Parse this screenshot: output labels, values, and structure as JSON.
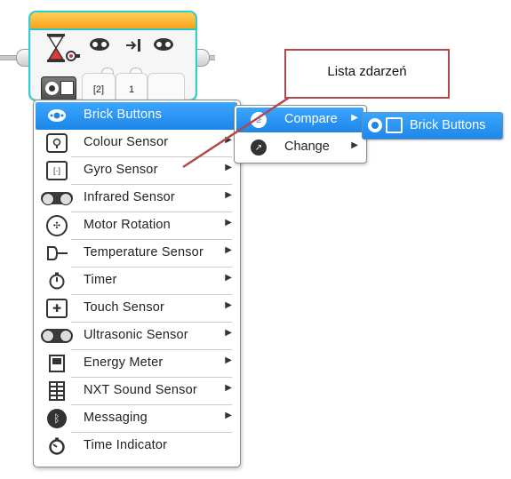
{
  "block": {
    "param1": "[2]",
    "param2": "1"
  },
  "menu": {
    "items": [
      {
        "label": "Brick Buttons",
        "icon": "brick-buttons-icon",
        "selected": true,
        "has_submenu": true
      },
      {
        "label": "Colour Sensor",
        "icon": "colour-sensor-icon",
        "has_submenu": true
      },
      {
        "label": "Gyro Sensor",
        "icon": "gyro-sensor-icon",
        "has_submenu": true
      },
      {
        "label": "Infrared Sensor",
        "icon": "infrared-sensor-icon",
        "has_submenu": true
      },
      {
        "label": "Motor Rotation",
        "icon": "motor-rotation-icon",
        "has_submenu": true
      },
      {
        "label": "Temperature Sensor",
        "icon": "temperature-sensor-icon",
        "has_submenu": true
      },
      {
        "label": "Timer",
        "icon": "timer-icon",
        "has_submenu": true
      },
      {
        "label": "Touch Sensor",
        "icon": "touch-sensor-icon",
        "has_submenu": true
      },
      {
        "label": "Ultrasonic Sensor",
        "icon": "ultrasonic-sensor-icon",
        "has_submenu": true
      },
      {
        "label": "Energy Meter",
        "icon": "energy-meter-icon",
        "has_submenu": true
      },
      {
        "label": "NXT Sound Sensor",
        "icon": "nxt-sound-sensor-icon",
        "has_submenu": true
      },
      {
        "label": "Messaging",
        "icon": "messaging-icon",
        "has_submenu": true
      },
      {
        "label": "Time Indicator",
        "icon": "time-indicator-icon",
        "has_submenu": false
      }
    ]
  },
  "submenu": {
    "items": [
      {
        "label": "Compare",
        "selected": true
      },
      {
        "label": "Change",
        "selected": false
      }
    ]
  },
  "chip": {
    "label": "Brick Buttons"
  },
  "callout": {
    "label": "Lista zdarzeń"
  },
  "colors": {
    "highlight": "#1f86e8",
    "block_header": "#f7a21b",
    "block_outline": "#2ad0d2",
    "callout_border": "#b04a4a"
  }
}
